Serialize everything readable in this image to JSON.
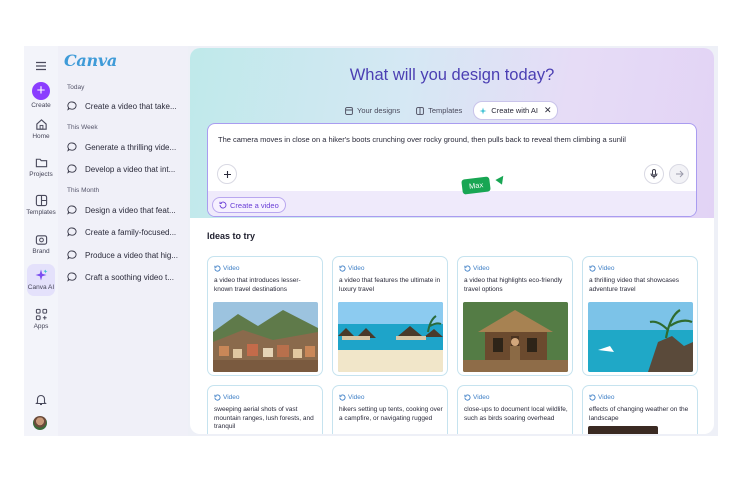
{
  "rail": {
    "items": [
      {
        "label": "Create",
        "icon": "plus-icon"
      },
      {
        "label": "Home",
        "icon": "home-icon"
      },
      {
        "label": "Projects",
        "icon": "folder-icon"
      },
      {
        "label": "Templates",
        "icon": "templates-icon"
      },
      {
        "label": "Brand",
        "icon": "brand-icon"
      },
      {
        "label": "Canva AI",
        "icon": "sparkle-icon"
      },
      {
        "label": "Apps",
        "icon": "apps-icon"
      }
    ]
  },
  "history": {
    "logo": "Canva",
    "sections": [
      {
        "label": "Today",
        "items": [
          "Create a video that take..."
        ]
      },
      {
        "label": "This Week",
        "items": [
          "Generate a thrilling vide...",
          "Develop a video that int..."
        ]
      },
      {
        "label": "This Month",
        "items": [
          "Design a video that feat...",
          "Create a family-focused...",
          "Produce a video that hig...",
          "Craft a soothing video t..."
        ]
      }
    ]
  },
  "main": {
    "title": "What will you design today?",
    "tabs": [
      {
        "label": "Your designs",
        "icon": "designs-icon"
      },
      {
        "label": "Templates",
        "icon": "templates-icon"
      },
      {
        "label": "Create with AI",
        "icon": "sparkle-icon",
        "active": true
      }
    ],
    "prompt_text": "The camera moves in close on a hiker's boots crunching over rocky ground, then pulls back to reveal them climbing a sunlil",
    "create_video_label": "Create a video",
    "cursor_label": "Max",
    "ideas_title": "Ideas to try",
    "ideas": [
      {
        "tag": "Video",
        "text": "a video that introduces lesser-known travel destinations"
      },
      {
        "tag": "Video",
        "text": "a video that features the ultimate in luxury travel"
      },
      {
        "tag": "Video",
        "text": "a video that highlights eco-friendly travel options"
      },
      {
        "tag": "Video",
        "text": "a thrilling video that showcases adventure travel"
      },
      {
        "tag": "Video",
        "text": "sweeping aerial shots of vast mountain ranges, lush forests, and tranquil"
      },
      {
        "tag": "Video",
        "text": "hikers setting up tents, cooking over a campfire, or navigating rugged"
      },
      {
        "tag": "Video",
        "text": "close-ups to document local wildlife, such as birds soaring overhead"
      },
      {
        "tag": "Video",
        "text": "effects of changing weather on the landscape"
      }
    ]
  },
  "colors": {
    "accent": "#8b3dff",
    "title": "#4b3fb3",
    "cursor": "#18a653",
    "tag": "#3e7fc6"
  }
}
